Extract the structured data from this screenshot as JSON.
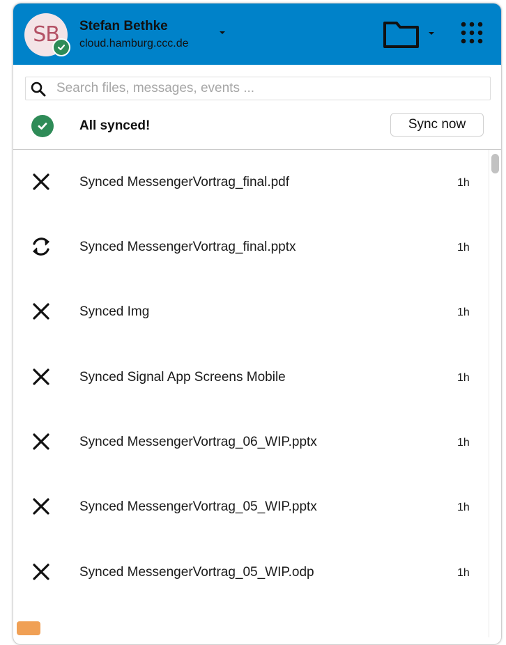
{
  "colors": {
    "header_bg": "#0082c9",
    "synced_green": "#2e8b57",
    "avatar_bg": "#f4e4e7",
    "avatar_text": "#b45266"
  },
  "account": {
    "initials": "SB",
    "name": "Stefan Bethke",
    "server": "cloud.hamburg.ccc.de",
    "status_icon": "check-circle-icon"
  },
  "header": {
    "folder_icon": "folder-icon",
    "apps_icon": "apps-grid-icon"
  },
  "search": {
    "placeholder": "Search files, messages, events ..."
  },
  "status": {
    "text": "All synced!",
    "icon": "check-circle-icon",
    "sync_button": "Sync now"
  },
  "activities": [
    {
      "icon": "close-icon",
      "text": "Synced MessengerVortrag_final.pdf",
      "time": "1h"
    },
    {
      "icon": "sync-icon",
      "text": "Synced MessengerVortrag_final.pptx",
      "time": "1h"
    },
    {
      "icon": "close-icon",
      "text": "Synced Img",
      "time": "1h"
    },
    {
      "icon": "close-icon",
      "text": "Synced Signal App Screens Mobile",
      "time": "1h"
    },
    {
      "icon": "close-icon",
      "text": "Synced MessengerVortrag_06_WIP.pptx",
      "time": "1h"
    },
    {
      "icon": "close-icon",
      "text": "Synced MessengerVortrag_05_WIP.pptx",
      "time": "1h"
    },
    {
      "icon": "close-icon",
      "text": "Synced MessengerVortrag_05_WIP.odp",
      "time": "1h"
    }
  ]
}
